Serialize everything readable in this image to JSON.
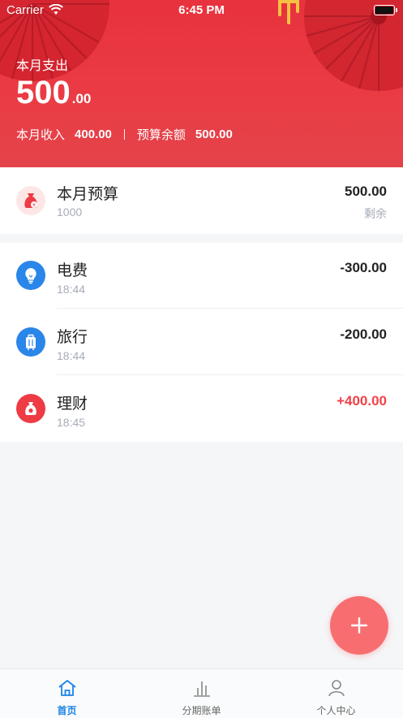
{
  "status_bar": {
    "carrier": "Carrier",
    "time": "6:45 PM"
  },
  "header": {
    "label": "本月支出",
    "amount_int": "500",
    "amount_dec": ".00",
    "income_label": "本月收入",
    "income_value": "400.00",
    "balance_label": "预算余额",
    "balance_value": "500.00"
  },
  "budget": {
    "title": "本月预算",
    "total": "1000",
    "remaining_value": "500.00",
    "remaining_label": "剩余"
  },
  "transactions": [
    {
      "icon": "lightbulb-icon",
      "title": "电费",
      "time": "18:44",
      "amount": "-300.00",
      "type": "expense",
      "color": "#2a86e8"
    },
    {
      "icon": "suitcase-icon",
      "title": "旅行",
      "time": "18:44",
      "amount": "-200.00",
      "type": "expense",
      "color": "#2a86e8"
    },
    {
      "icon": "money-bag-icon",
      "title": "理财",
      "time": "18:45",
      "amount": "+400.00",
      "type": "income",
      "color": "#ee3b44"
    }
  ],
  "tabs": [
    {
      "label": "首页",
      "icon": "home-icon",
      "active": true
    },
    {
      "label": "分期账单",
      "icon": "bar-chart-icon",
      "active": false
    },
    {
      "label": "个人中心",
      "icon": "person-icon",
      "active": false
    }
  ],
  "colors": {
    "brand_red": "#e8323d",
    "income_red": "#f24148",
    "accent_blue": "#1a82e6",
    "fab": "#f86e70"
  }
}
